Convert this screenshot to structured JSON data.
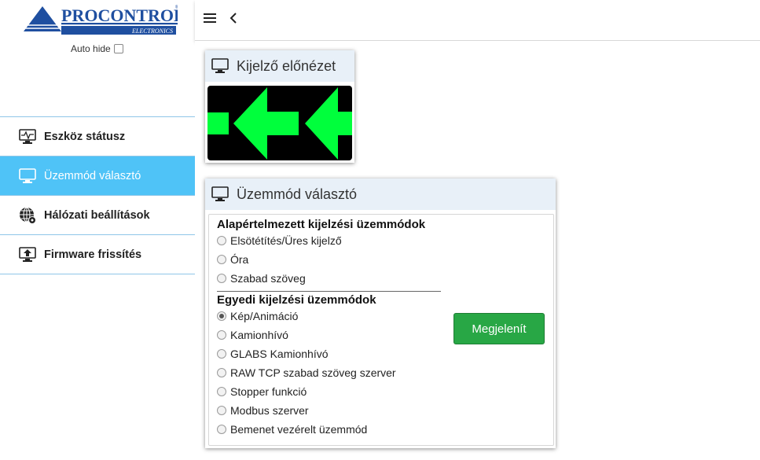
{
  "brand": {
    "name": "PROCONTROL",
    "sub": "ELECTRONICS",
    "reg": "®"
  },
  "sidebar": {
    "auto_hide_label": "Auto hide",
    "items": [
      {
        "label": "Eszköz státusz",
        "icon": "monitor-pulse-icon"
      },
      {
        "label": "Üzemmód választó",
        "icon": "monitor-icon",
        "active": true
      },
      {
        "label": "Hálózati beállítások",
        "icon": "globe-settings-icon"
      },
      {
        "label": "Firmware frissítés",
        "icon": "monitor-upload-icon"
      }
    ]
  },
  "topbar": {
    "menu_icon": "hamburger-icon",
    "back_icon": "chevron-left-icon"
  },
  "preview": {
    "title": "Kijelző előnézet",
    "arrow_color": "#00ff3c"
  },
  "mode": {
    "title": "Üzemmód választó",
    "group1_title": "Alapértelmezett kijelzési üzemmódok",
    "group1_options": [
      "Elsötétítés/Üres kijelző",
      "Óra",
      "Szabad szöveg"
    ],
    "group2_title": "Egyedi kijelzési üzemmódok",
    "group2_options": [
      "Kép/Animáció",
      "Kamionhívó",
      "GLABS Kamionhívó",
      "RAW TCP szabad szöveg szerver",
      "Stopper funkció",
      "Modbus szerver",
      "Bemenet vezérelt üzemmód"
    ],
    "selected": "Kép/Animáció",
    "show_button": "Megjelenít"
  },
  "colors": {
    "accent": "#4fc3f7",
    "button_green": "#28a745",
    "logo_blue": "#1f4fa0"
  }
}
